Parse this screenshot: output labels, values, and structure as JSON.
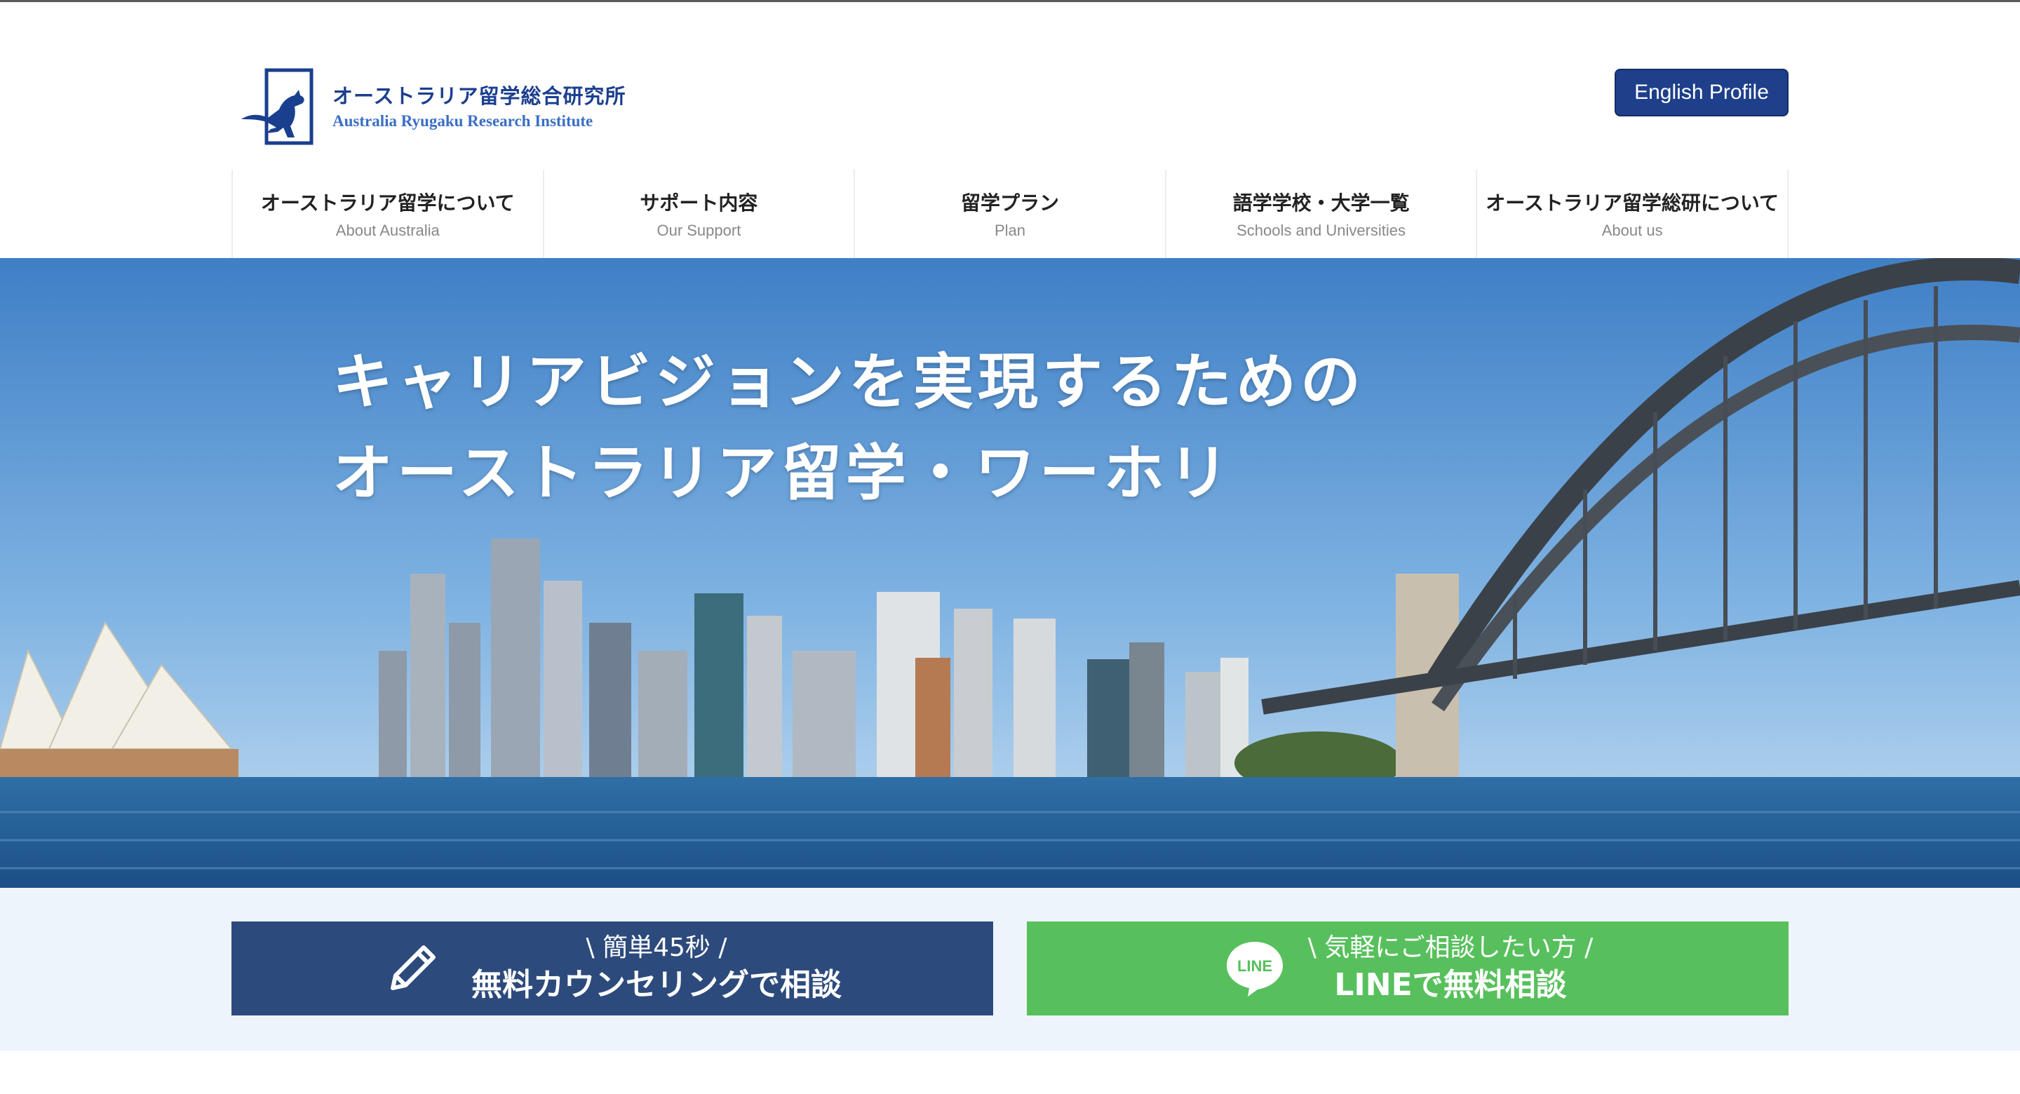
{
  "header": {
    "logo": {
      "jp": "オーストラリア留学総合研究所",
      "en": "Australia Ryugaku Research Institute",
      "icon": "kangaroo-logo-icon"
    },
    "english_button": "English Profile"
  },
  "nav": [
    {
      "jp": "オーストラリア留学について",
      "en": "About Australia"
    },
    {
      "jp": "サポート内容",
      "en": "Our Support"
    },
    {
      "jp": "留学プラン",
      "en": "Plan"
    },
    {
      "jp": "語学学校・大学一覧",
      "en": "Schools and Universities"
    },
    {
      "jp": "オーストラリア留学総研について",
      "en": "About us"
    }
  ],
  "hero": {
    "line1": "キャリアビジョンを実現するための",
    "line2": "オーストラリア留学・ワーホリ",
    "image": "sydney-harbour-skyline"
  },
  "cta": {
    "counseling": {
      "sub": "\\ 簡単45秒 /",
      "main": "無料カウンセリングで相談",
      "icon": "pencil-icon"
    },
    "line": {
      "sub": "\\ 気軽にご相談したい方 /",
      "main": "LINEで無料相談",
      "icon": "line-icon",
      "icon_text": "LINE"
    }
  },
  "colors": {
    "brand_navy": "#1e3f8a",
    "cta_blue": "#2c4a7c",
    "cta_green": "#57c05c",
    "strip_bg": "#eef4fc"
  }
}
